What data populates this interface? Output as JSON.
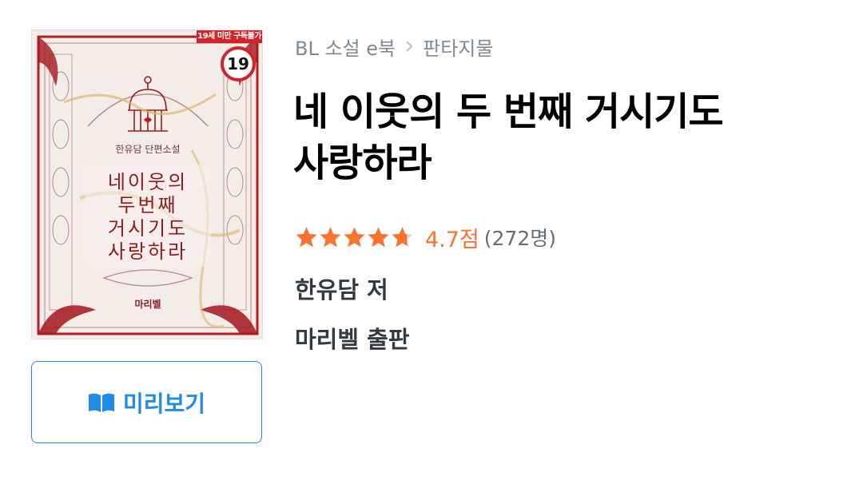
{
  "cover": {
    "age_banner": "19세 미만 구독불가",
    "age_badge": "19",
    "author_line": "한유담 단편소설",
    "title_lines": [
      "네이웃의",
      "두번째",
      "거시기도",
      "사랑하라"
    ],
    "publisher": "마리벨"
  },
  "preview_button": {
    "label": "미리보기",
    "icon": "open-book-icon"
  },
  "breadcrumb": {
    "category": "BL 소설 e북",
    "subcategory": "판타지물"
  },
  "book": {
    "title_lines": [
      "네 이웃의 두 번째 거시기도",
      "사랑하라"
    ],
    "rating_value": 4.7,
    "rating_text": "4.7점",
    "rating_count": "(272명)",
    "author": "한유담 저",
    "publisher": "마리벨 출판"
  },
  "colors": {
    "accent_blue": "#1f8ce6",
    "star_orange": "#fa722e",
    "star_empty": "#d1d5d9",
    "age_red": "#d2232a"
  }
}
